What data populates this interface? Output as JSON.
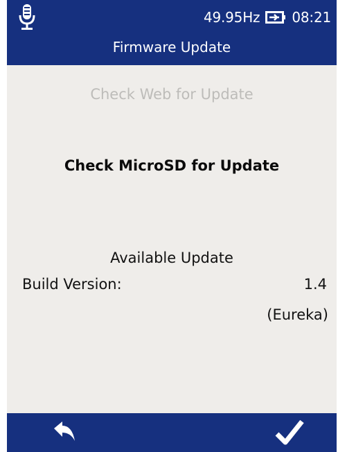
{
  "header": {
    "frequency": "49.95Hz",
    "time": "08:21",
    "title": "Firmware Update",
    "icons": [
      "microphone-icon",
      "battery-icon"
    ]
  },
  "options": {
    "web_update": "Check Web for Update",
    "sd_update": "Check MicroSD for Update"
  },
  "update_info": {
    "heading": "Available Update",
    "build_label": "Build Version:",
    "build_version": "1.4",
    "build_name": "(Eureka)"
  },
  "footer": {
    "back_icon": "back-arrow-icon",
    "confirm_icon": "checkmark-icon"
  },
  "colors": {
    "header_bg": "#16307f",
    "content_bg": "#efedea",
    "disabled_text": "#bdbcb9"
  }
}
